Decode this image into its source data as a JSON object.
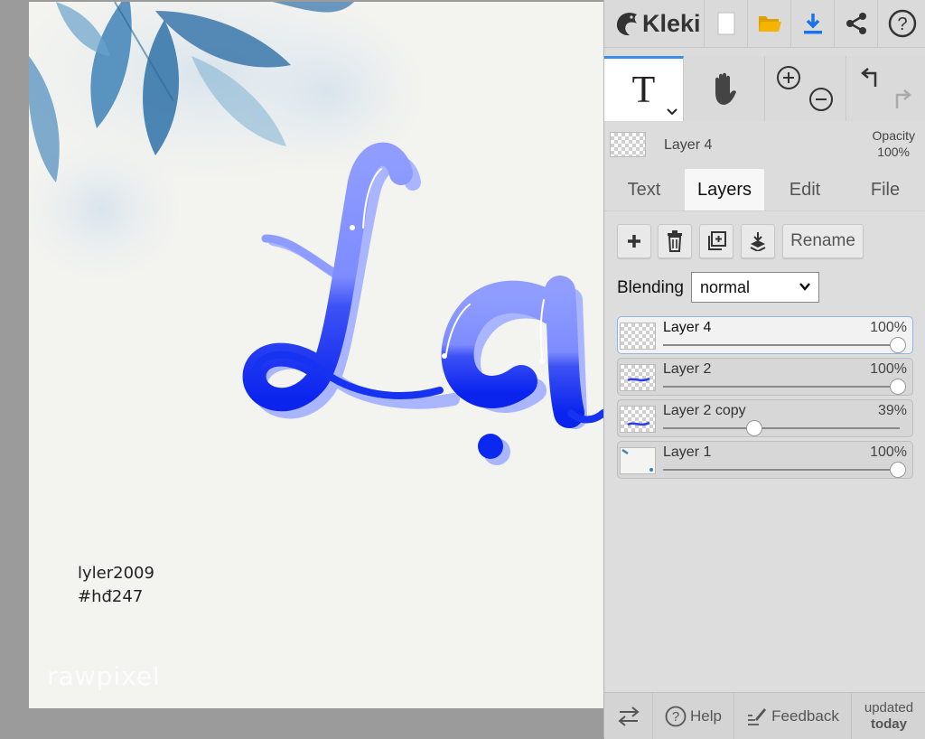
{
  "app": {
    "name": "Kleki"
  },
  "topbar": {
    "icons": [
      "new-document-icon",
      "open-folder-icon",
      "download-icon",
      "share-icon",
      "help-icon"
    ],
    "colors": {
      "folder": "#f5b400",
      "download": "#1a73e8"
    }
  },
  "tools": {
    "text_tool_glyph": "T",
    "items": [
      "text-tool",
      "hand-tool",
      "zoom-in-out",
      "undo-redo"
    ]
  },
  "current_layer": {
    "name": "Layer 4",
    "opacity_label": "Opacity",
    "opacity_value": "100%"
  },
  "tabs": [
    {
      "label": "Text",
      "active": false
    },
    {
      "label": "Layers",
      "active": true
    },
    {
      "label": "Edit",
      "active": false
    },
    {
      "label": "File",
      "active": false
    }
  ],
  "layers_panel": {
    "rename_label": "Rename",
    "blending_label": "Blending",
    "blending_value": "normal",
    "layers": [
      {
        "name": "Layer 4",
        "opacity": "100%",
        "opacity_fraction": 1.0,
        "selected": true
      },
      {
        "name": "Layer 2",
        "opacity": "100%",
        "opacity_fraction": 1.0,
        "selected": false
      },
      {
        "name": "Layer 2 copy",
        "opacity": "39%",
        "opacity_fraction": 0.39,
        "selected": false
      },
      {
        "name": "Layer 1",
        "opacity": "100%",
        "opacity_fraction": 1.0,
        "selected": false
      }
    ]
  },
  "bottombar": {
    "help_label": "Help",
    "feedback_label": "Feedback",
    "updated_line1": "updated",
    "updated_line2": "today"
  },
  "canvas": {
    "artwork_text": "Lạ",
    "signature_line1": "lyler2009",
    "signature_line2": "#hđ247",
    "watermark": "rawpixel",
    "colors": {
      "letter_top": "#8f9cff",
      "letter_bottom": "#0a28f0",
      "shadow": "#a9b4ff"
    }
  }
}
